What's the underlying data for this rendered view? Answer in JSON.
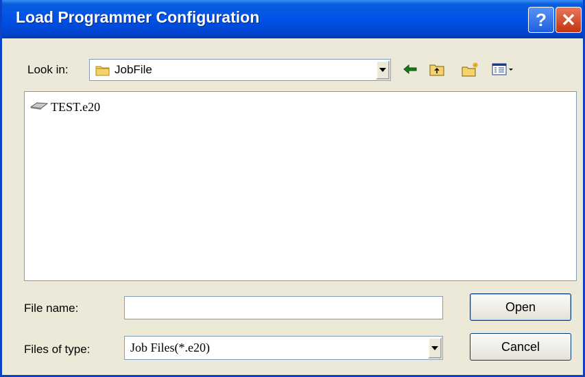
{
  "window": {
    "title": "Load Programmer Configuration"
  },
  "titlebar": {
    "help_label": "?",
    "close_label": "✕"
  },
  "lookin": {
    "label": "Look in:",
    "value": "JobFile"
  },
  "toolbar": {
    "icons": [
      "back-icon",
      "up-folder-icon",
      "new-folder-icon",
      "view-menu-icon"
    ]
  },
  "files": [
    {
      "name": "TEST.e20",
      "icon": "job-file-icon"
    }
  ],
  "filename": {
    "label": "File name:",
    "value": ""
  },
  "filetype": {
    "label": "Files of type:",
    "value": "Job Files(*.e20)"
  },
  "buttons": {
    "open": "Open",
    "cancel": "Cancel"
  },
  "colors": {
    "title_bar": "#0050e6",
    "dialog_bg": "#ece9d8",
    "close": "#c2330f"
  }
}
